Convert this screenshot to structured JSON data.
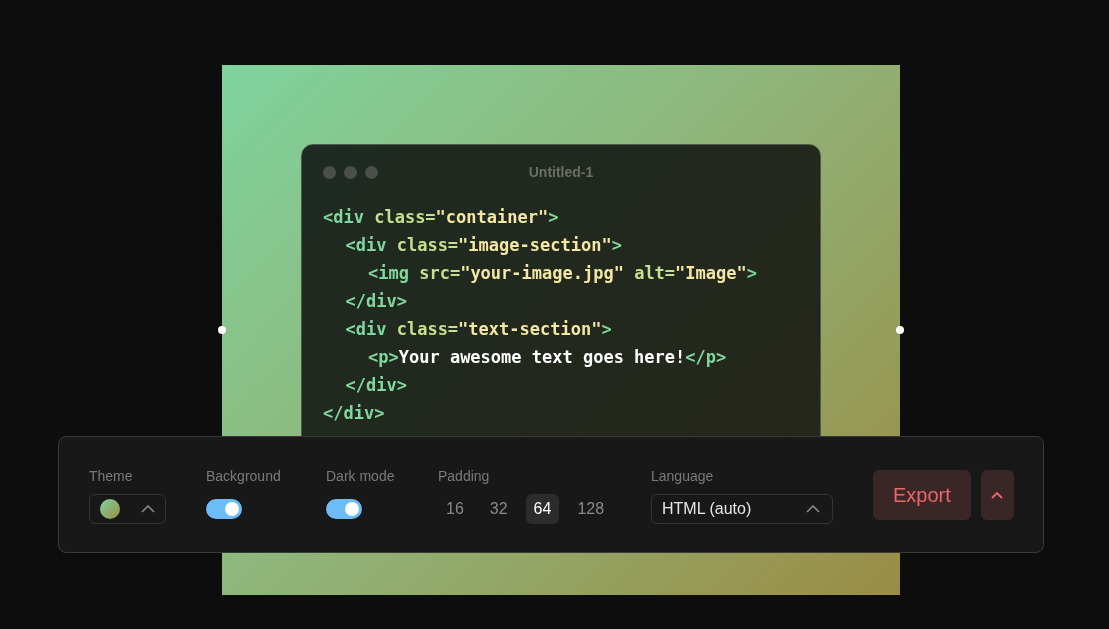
{
  "editor": {
    "title": "Untitled-1",
    "code": [
      {
        "tokens": [
          {
            "kind": "tag",
            "text": "<div"
          },
          {
            "kind": "attr",
            "text": " class="
          },
          {
            "kind": "string",
            "text": "\"container\""
          },
          {
            "kind": "tag",
            "text": ">"
          }
        ],
        "children": [
          {
            "tokens": [
              {
                "kind": "tag",
                "text": "<div"
              },
              {
                "kind": "attr",
                "text": " class="
              },
              {
                "kind": "string",
                "text": "\"image-section\""
              },
              {
                "kind": "tag",
                "text": ">"
              }
            ],
            "children": [
              {
                "tokens": [
                  {
                    "kind": "tag",
                    "text": "<img"
                  },
                  {
                    "kind": "attr",
                    "text": " src="
                  },
                  {
                    "kind": "string",
                    "text": "\"your-image.jpg\""
                  },
                  {
                    "kind": "attr",
                    "text": " alt="
                  },
                  {
                    "kind": "string",
                    "text": "\"Image\""
                  },
                  {
                    "kind": "tag",
                    "text": ">"
                  }
                ]
              }
            ]
          },
          {
            "tokens": [
              {
                "kind": "tag",
                "text": "</div>"
              }
            ]
          },
          {
            "tokens": [
              {
                "kind": "tag",
                "text": "<div"
              },
              {
                "kind": "attr",
                "text": " class="
              },
              {
                "kind": "string",
                "text": "\"text-section\""
              },
              {
                "kind": "tag",
                "text": ">"
              }
            ],
            "children": [
              {
                "tokens": [
                  {
                    "kind": "tag",
                    "text": "<p>"
                  },
                  {
                    "kind": "text",
                    "text": "Your awesome text goes here!"
                  },
                  {
                    "kind": "tag",
                    "text": "</p>"
                  }
                ]
              }
            ]
          },
          {
            "tokens": [
              {
                "kind": "tag",
                "text": "</div>"
              }
            ]
          }
        ]
      },
      {
        "tokens": [
          {
            "kind": "tag",
            "text": "</div>"
          }
        ]
      }
    ]
  },
  "toolbar": {
    "theme": {
      "label": "Theme"
    },
    "background": {
      "label": "Background",
      "on": true
    },
    "dark_mode": {
      "label": "Dark mode",
      "on": true
    },
    "padding": {
      "label": "Padding",
      "options": [
        {
          "label": "16",
          "selected": false
        },
        {
          "label": "32",
          "selected": false
        },
        {
          "label": "64",
          "selected": true
        },
        {
          "label": "128",
          "selected": false
        }
      ]
    },
    "language": {
      "label": "Language",
      "value": "HTML (auto)"
    },
    "export": {
      "label": "Export"
    }
  }
}
